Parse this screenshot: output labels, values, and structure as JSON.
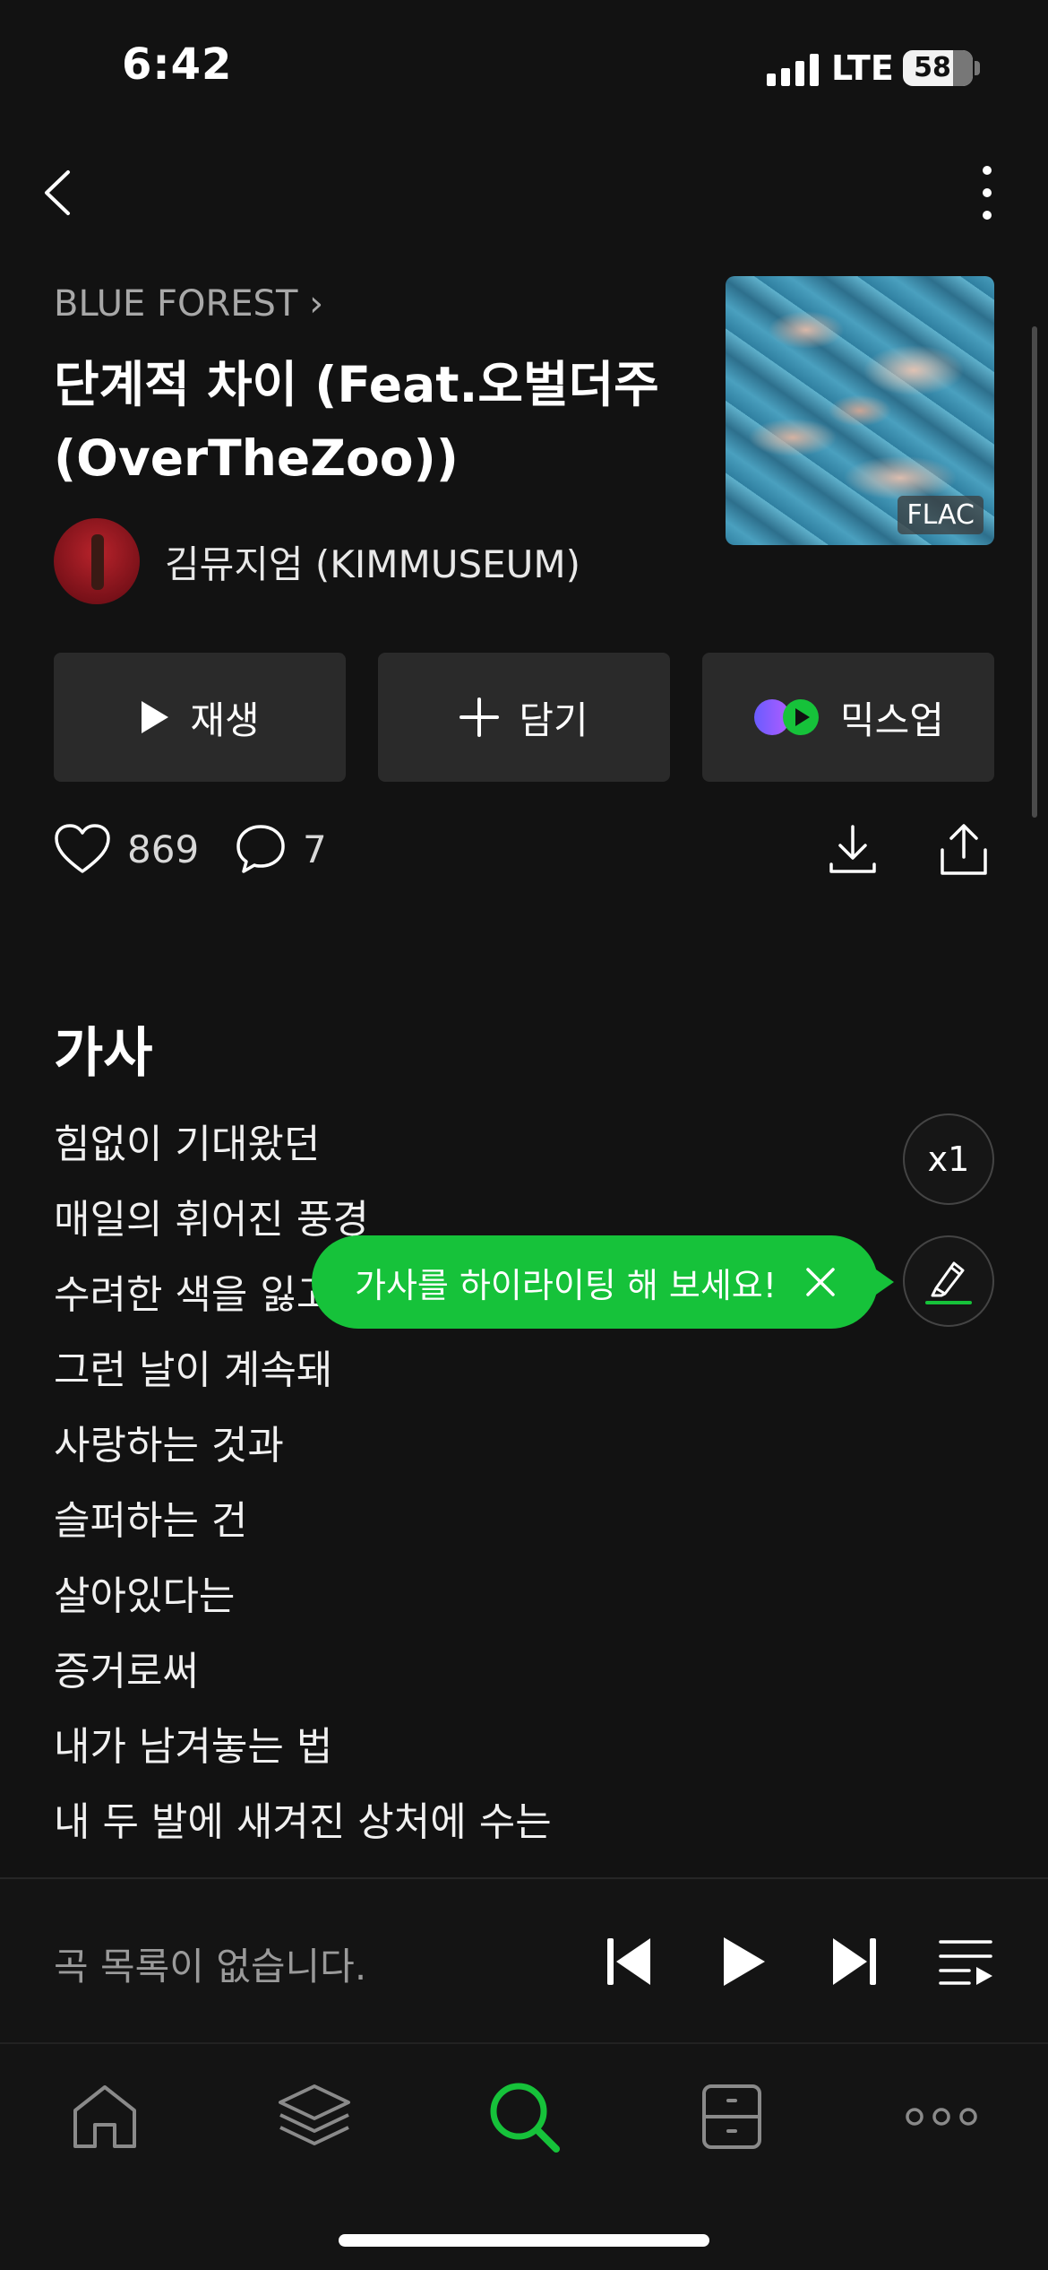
{
  "status_bar": {
    "time": "6:42",
    "network": "LTE",
    "battery": "58"
  },
  "song": {
    "album_link": "BLUE FOREST",
    "title": "단계적 차이 (Feat.오벌더주 (OverTheZoo))",
    "artist": "김뮤지엄 (KIMMUSEUM)",
    "quality_badge": "FLAC"
  },
  "actions": {
    "play_label": "재생",
    "add_label": "담기",
    "mixup_label": "믹스업"
  },
  "stats": {
    "likes": "869",
    "comments": "7"
  },
  "lyrics": {
    "heading": "가사",
    "speed": "x1",
    "tooltip": "가사를 하이라이팅 해 보세요!",
    "lines": [
      "힘없이 기대왔던",
      "매일의 휘어진 풍경",
      "수려한 색을 잃고",
      "그런 날이 계속돼",
      "사랑하는 것과",
      "슬퍼하는 건",
      "살아있다는",
      "증거로써",
      "내가 남겨놓는 법",
      "내 두 발에 새겨진 상처에 수는"
    ]
  },
  "mini_player": {
    "status_text": "곡 목록이 없습니다."
  },
  "tabs": [
    "home-icon",
    "layers-icon",
    "search-icon",
    "library-icon",
    "more-icon"
  ],
  "colors": {
    "accent": "#16c23a",
    "background": "#121212",
    "button_bg": "#2a2a2a"
  }
}
